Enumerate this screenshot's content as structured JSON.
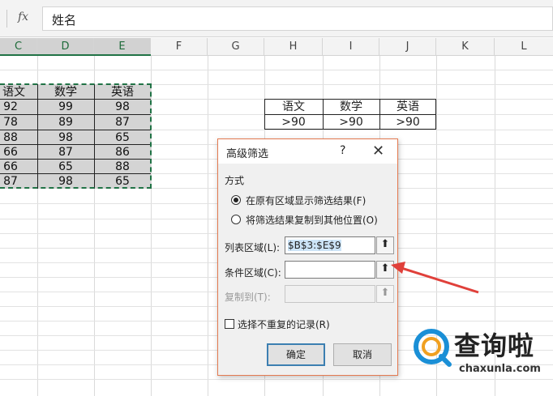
{
  "formula_bar": {
    "fx_label": "fx",
    "content": "姓名"
  },
  "columns": [
    "C",
    "D",
    "E",
    "F",
    "G",
    "H",
    "I",
    "J",
    "K",
    "L"
  ],
  "data_table": {
    "headers": [
      "语文",
      "数学",
      "英语"
    ],
    "rows": [
      [
        "92",
        "99",
        "98"
      ],
      [
        "78",
        "89",
        "87"
      ],
      [
        "88",
        "98",
        "65"
      ],
      [
        "66",
        "87",
        "86"
      ],
      [
        "66",
        "65",
        "88"
      ],
      [
        "87",
        "98",
        "65"
      ]
    ]
  },
  "criteria_table": {
    "headers": [
      "语文",
      "数学",
      "英语"
    ],
    "values": [
      ">90",
      ">90",
      ">90"
    ]
  },
  "dialog": {
    "title": "高级筛选",
    "help": "?",
    "close": "✕",
    "mode_label": "方式",
    "radio_in_place": "在原有区域显示筛选结果(F)",
    "radio_copy": "将筛选结果复制到其他位置(O)",
    "list_range_label": "列表区域(L):",
    "list_range_value": "$B$3:$E$9",
    "criteria_range_label": "条件区域(C):",
    "criteria_range_value": "",
    "copy_to_label": "复制到(T):",
    "copy_to_value": "",
    "unique_label": "选择不重复的记录(R)",
    "ok": "确定",
    "cancel": "取消",
    "collapse_icon": "⬆"
  },
  "watermark": {
    "brand": "查询啦",
    "url": "chaxunla.com"
  },
  "colors": {
    "accent_green": "#217346",
    "arrow_red": "#e0403a",
    "dialog_border": "#e47a50",
    "default_button": "#3c7fb1",
    "watermark_blue": "#1a8fd6"
  }
}
